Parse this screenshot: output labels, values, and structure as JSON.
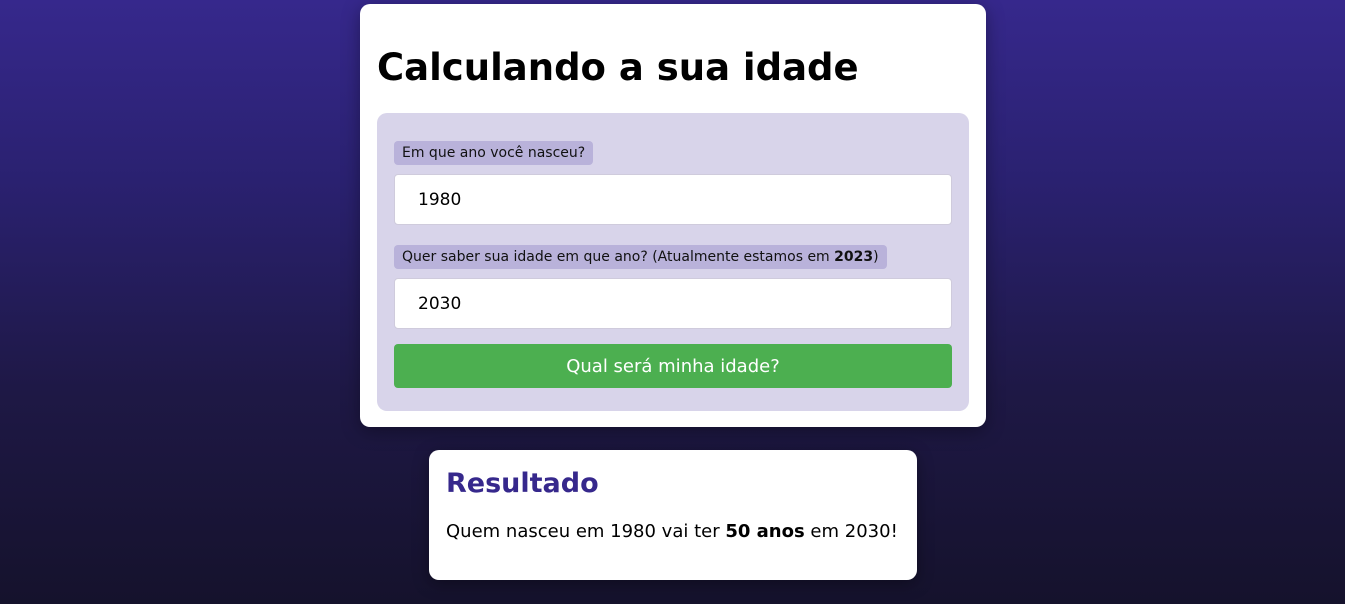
{
  "header": {
    "title": "Calculando a sua idade"
  },
  "form": {
    "birth_year": {
      "label": "Em que ano você nasceu?",
      "value": "1980"
    },
    "target_year": {
      "label_prefix": "Quer saber sua idade em que ano? (Atualmente estamos em ",
      "current_year": "2023",
      "label_suffix": ")",
      "value": "2030"
    },
    "submit_label": "Qual será minha idade?"
  },
  "result": {
    "title": "Resultado",
    "text_prefix": "Quem nasceu em 1980 vai ter ",
    "age": "50 anos",
    "text_suffix": " em 2030!"
  },
  "colors": {
    "accent": "#36288c",
    "button": "#4caf50",
    "panel": "#d8d4ea",
    "label_bg": "#b9b2da"
  }
}
